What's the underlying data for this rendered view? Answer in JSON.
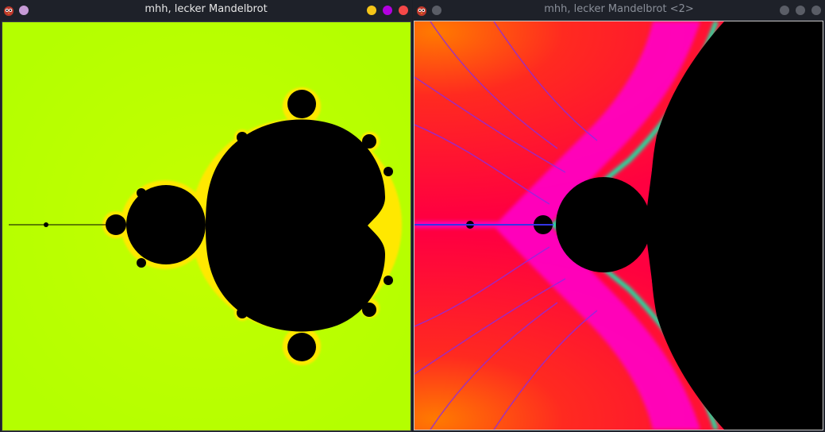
{
  "windows": [
    {
      "title": "mhh, lecker Mandelbrot",
      "state": "active",
      "buttons": [
        {
          "name": "minimize",
          "color": "#f5c518"
        },
        {
          "name": "maximize",
          "color": "#b300e0"
        },
        {
          "name": "close",
          "color": "#f54848"
        }
      ],
      "pin_color": "#c79bd6",
      "palette": {
        "background": "#b8ff00",
        "edge": "#ffe000",
        "set": "#000000"
      }
    },
    {
      "title": "mhh, lecker Mandelbrot <2>",
      "state": "inactive",
      "buttons": [
        {
          "name": "minimize",
          "color": "#5a5d66"
        },
        {
          "name": "maximize",
          "color": "#5a5d66"
        },
        {
          "name": "close",
          "color": "#5a5d66"
        }
      ],
      "pin_color": "#5a5d66",
      "palette": {
        "background": "#ff0030",
        "glow": "#ff6a00",
        "filaments": "#ff00ff",
        "edge": "#00ffa0",
        "set": "#000000"
      }
    }
  ]
}
